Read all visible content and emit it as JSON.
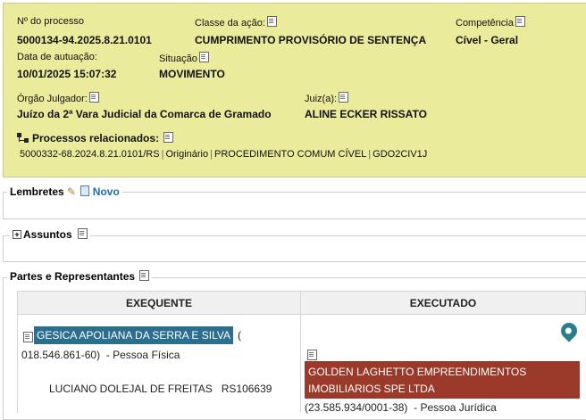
{
  "header": {
    "processo_label": "Nº do processo",
    "processo_value": "5000134-94.2025.8.21.0101",
    "classe_label": "Classe da ação:",
    "classe_value": "CUMPRIMENTO PROVISÓRIO DE SENTENÇA",
    "competencia_label": "Competência",
    "competencia_value": "Cível - Geral",
    "autuacao_label": "Data de autuação:",
    "autuacao_value": "10/01/2025 15:07:32",
    "situacao_label": "Situação",
    "situacao_value": "MOVIMENTO",
    "orgao_label": "Órgão Julgador:",
    "orgao_value": "Juízo da 2ª Vara Judicial da Comarca de Gramado",
    "juiz_label": "Juiz(a):",
    "juiz_value": "ALINE ECKER RISSATO",
    "relacionados_label": "Processos relacionados:",
    "relacionado": {
      "numero": "5000332-68.2024.8.21.0101/RS",
      "tipo": "Originário",
      "classe": "PROCEDIMENTO COMUM CÍVEL",
      "orgao": "GDO2CIV1J",
      "separator": "|"
    }
  },
  "lembretes": {
    "label": "Lembretes",
    "novo_label": "Novo"
  },
  "assuntos": {
    "label": "Assuntos",
    "toggle": "+"
  },
  "partes": {
    "label": "Partes e Representantes",
    "col_exequente": "EXEQUENTE",
    "col_executado": "EXECUTADO",
    "exequente_name": "GESICA APOLIANA DA SERRA E SILVA",
    "exequente_paren": "(",
    "exequente_doc": "018.546.861-60)",
    "exequente_tipo": "- Pessoa Física",
    "advogado": "LUCIANO DOLEJAL DE FREITAS",
    "oab": "RS106639",
    "executado_name_line1": "GOLDEN LAGHETTO EMPREENDIMENTOS",
    "executado_name_line2": "IMOBILIARIOS SPE LTDA",
    "executado_doc": "(23.585.934/0001-38)",
    "executado_tipo": "- Pessoa Jurídica"
  }
}
